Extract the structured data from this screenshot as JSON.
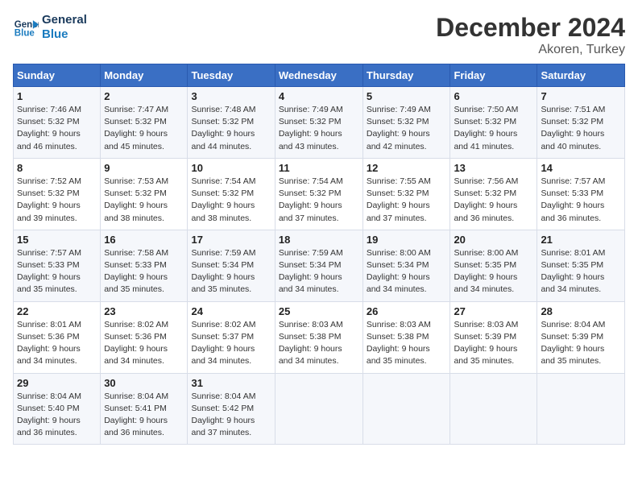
{
  "header": {
    "logo_line1": "General",
    "logo_line2": "Blue",
    "title": "December 2024",
    "subtitle": "Akoren, Turkey"
  },
  "columns": [
    "Sunday",
    "Monday",
    "Tuesday",
    "Wednesday",
    "Thursday",
    "Friday",
    "Saturday"
  ],
  "weeks": [
    [
      {
        "day": "1",
        "detail": "Sunrise: 7:46 AM\nSunset: 5:32 PM\nDaylight: 9 hours\nand 46 minutes."
      },
      {
        "day": "2",
        "detail": "Sunrise: 7:47 AM\nSunset: 5:32 PM\nDaylight: 9 hours\nand 45 minutes."
      },
      {
        "day": "3",
        "detail": "Sunrise: 7:48 AM\nSunset: 5:32 PM\nDaylight: 9 hours\nand 44 minutes."
      },
      {
        "day": "4",
        "detail": "Sunrise: 7:49 AM\nSunset: 5:32 PM\nDaylight: 9 hours\nand 43 minutes."
      },
      {
        "day": "5",
        "detail": "Sunrise: 7:49 AM\nSunset: 5:32 PM\nDaylight: 9 hours\nand 42 minutes."
      },
      {
        "day": "6",
        "detail": "Sunrise: 7:50 AM\nSunset: 5:32 PM\nDaylight: 9 hours\nand 41 minutes."
      },
      {
        "day": "7",
        "detail": "Sunrise: 7:51 AM\nSunset: 5:32 PM\nDaylight: 9 hours\nand 40 minutes."
      }
    ],
    [
      {
        "day": "8",
        "detail": "Sunrise: 7:52 AM\nSunset: 5:32 PM\nDaylight: 9 hours\nand 39 minutes."
      },
      {
        "day": "9",
        "detail": "Sunrise: 7:53 AM\nSunset: 5:32 PM\nDaylight: 9 hours\nand 38 minutes."
      },
      {
        "day": "10",
        "detail": "Sunrise: 7:54 AM\nSunset: 5:32 PM\nDaylight: 9 hours\nand 38 minutes."
      },
      {
        "day": "11",
        "detail": "Sunrise: 7:54 AM\nSunset: 5:32 PM\nDaylight: 9 hours\nand 37 minutes."
      },
      {
        "day": "12",
        "detail": "Sunrise: 7:55 AM\nSunset: 5:32 PM\nDaylight: 9 hours\nand 37 minutes."
      },
      {
        "day": "13",
        "detail": "Sunrise: 7:56 AM\nSunset: 5:32 PM\nDaylight: 9 hours\nand 36 minutes."
      },
      {
        "day": "14",
        "detail": "Sunrise: 7:57 AM\nSunset: 5:33 PM\nDaylight: 9 hours\nand 36 minutes."
      }
    ],
    [
      {
        "day": "15",
        "detail": "Sunrise: 7:57 AM\nSunset: 5:33 PM\nDaylight: 9 hours\nand 35 minutes."
      },
      {
        "day": "16",
        "detail": "Sunrise: 7:58 AM\nSunset: 5:33 PM\nDaylight: 9 hours\nand 35 minutes."
      },
      {
        "day": "17",
        "detail": "Sunrise: 7:59 AM\nSunset: 5:34 PM\nDaylight: 9 hours\nand 35 minutes."
      },
      {
        "day": "18",
        "detail": "Sunrise: 7:59 AM\nSunset: 5:34 PM\nDaylight: 9 hours\nand 34 minutes."
      },
      {
        "day": "19",
        "detail": "Sunrise: 8:00 AM\nSunset: 5:34 PM\nDaylight: 9 hours\nand 34 minutes."
      },
      {
        "day": "20",
        "detail": "Sunrise: 8:00 AM\nSunset: 5:35 PM\nDaylight: 9 hours\nand 34 minutes."
      },
      {
        "day": "21",
        "detail": "Sunrise: 8:01 AM\nSunset: 5:35 PM\nDaylight: 9 hours\nand 34 minutes."
      }
    ],
    [
      {
        "day": "22",
        "detail": "Sunrise: 8:01 AM\nSunset: 5:36 PM\nDaylight: 9 hours\nand 34 minutes."
      },
      {
        "day": "23",
        "detail": "Sunrise: 8:02 AM\nSunset: 5:36 PM\nDaylight: 9 hours\nand 34 minutes."
      },
      {
        "day": "24",
        "detail": "Sunrise: 8:02 AM\nSunset: 5:37 PM\nDaylight: 9 hours\nand 34 minutes."
      },
      {
        "day": "25",
        "detail": "Sunrise: 8:03 AM\nSunset: 5:38 PM\nDaylight: 9 hours\nand 34 minutes."
      },
      {
        "day": "26",
        "detail": "Sunrise: 8:03 AM\nSunset: 5:38 PM\nDaylight: 9 hours\nand 35 minutes."
      },
      {
        "day": "27",
        "detail": "Sunrise: 8:03 AM\nSunset: 5:39 PM\nDaylight: 9 hours\nand 35 minutes."
      },
      {
        "day": "28",
        "detail": "Sunrise: 8:04 AM\nSunset: 5:39 PM\nDaylight: 9 hours\nand 35 minutes."
      }
    ],
    [
      {
        "day": "29",
        "detail": "Sunrise: 8:04 AM\nSunset: 5:40 PM\nDaylight: 9 hours\nand 36 minutes."
      },
      {
        "day": "30",
        "detail": "Sunrise: 8:04 AM\nSunset: 5:41 PM\nDaylight: 9 hours\nand 36 minutes."
      },
      {
        "day": "31",
        "detail": "Sunrise: 8:04 AM\nSunset: 5:42 PM\nDaylight: 9 hours\nand 37 minutes."
      },
      null,
      null,
      null,
      null
    ]
  ]
}
